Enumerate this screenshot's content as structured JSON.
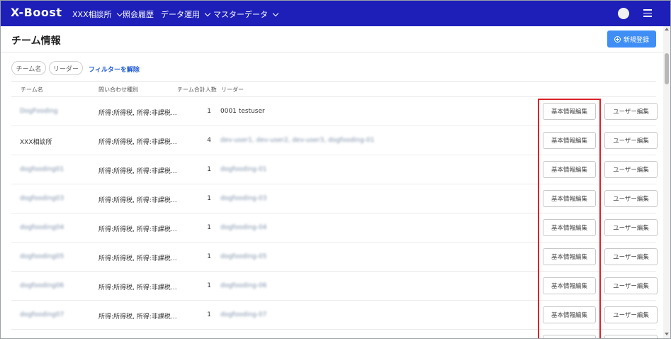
{
  "nav": {
    "logo": "X-Boost",
    "items": [
      {
        "label": "XXX相談所",
        "has_dropdown": true
      },
      {
        "label": "照会履歴",
        "has_dropdown": false
      },
      {
        "label": "データ運用",
        "has_dropdown": true
      },
      {
        "label": "マスターデータ",
        "has_dropdown": true
      }
    ],
    "icons": [
      "avatar",
      "menu-icon"
    ]
  },
  "page": {
    "title": "チーム情報",
    "new_button_label": "新規登録"
  },
  "filters": {
    "chips": [
      "チーム名",
      "リーダー"
    ],
    "clear_label": "フィルターを解除"
  },
  "table": {
    "headers": [
      "チーム名",
      "問い合わせ種別",
      "チーム合計人数",
      "リーダー"
    ],
    "edit_basic_label": "基本情報編集",
    "edit_user_label": "ユーザー編集",
    "rows": [
      {
        "team": "DogFooding",
        "types": "所得:所得税, 所得:非課税…",
        "count": "1",
        "leader": "0001 testuser",
        "team_blur": true,
        "leader_blur": false
      },
      {
        "team": "XXX相談所",
        "types": "所得:所得税, 所得:非課税…",
        "count": "4",
        "leader": "dev-user1, dev-user2, dev-user3, dogfooding-01",
        "team_blur": false,
        "leader_blur": true
      },
      {
        "team": "dogfooding01",
        "types": "所得:所得税, 所得:非課税…",
        "count": "1",
        "leader": "dogfooding-01",
        "team_blur": true,
        "leader_blur": true
      },
      {
        "team": "dogfooding03",
        "types": "所得:所得税, 所得:非課税…",
        "count": "1",
        "leader": "dogfooding-03",
        "team_blur": true,
        "leader_blur": true
      },
      {
        "team": "dogfooding04",
        "types": "所得:所得税, 所得:非課税…",
        "count": "1",
        "leader": "dogfooding-04",
        "team_blur": true,
        "leader_blur": true
      },
      {
        "team": "dogfooding05",
        "types": "所得:所得税, 所得:非課税…",
        "count": "1",
        "leader": "dogfooding-05",
        "team_blur": true,
        "leader_blur": true
      },
      {
        "team": "dogfooding06",
        "types": "所得:所得税, 所得:非課税…",
        "count": "1",
        "leader": "dogfooding-06",
        "team_blur": true,
        "leader_blur": true
      },
      {
        "team": "dogfooding07",
        "types": "所得:所得税, 所得:非課税…",
        "count": "1",
        "leader": "dogfooding-07",
        "team_blur": true,
        "leader_blur": true
      }
    ]
  },
  "colors": {
    "nav_bg": "#1d1fb8",
    "primary_button": "#3f8ef5",
    "link": "#1a57d6",
    "highlight_box": "#d9232a"
  }
}
